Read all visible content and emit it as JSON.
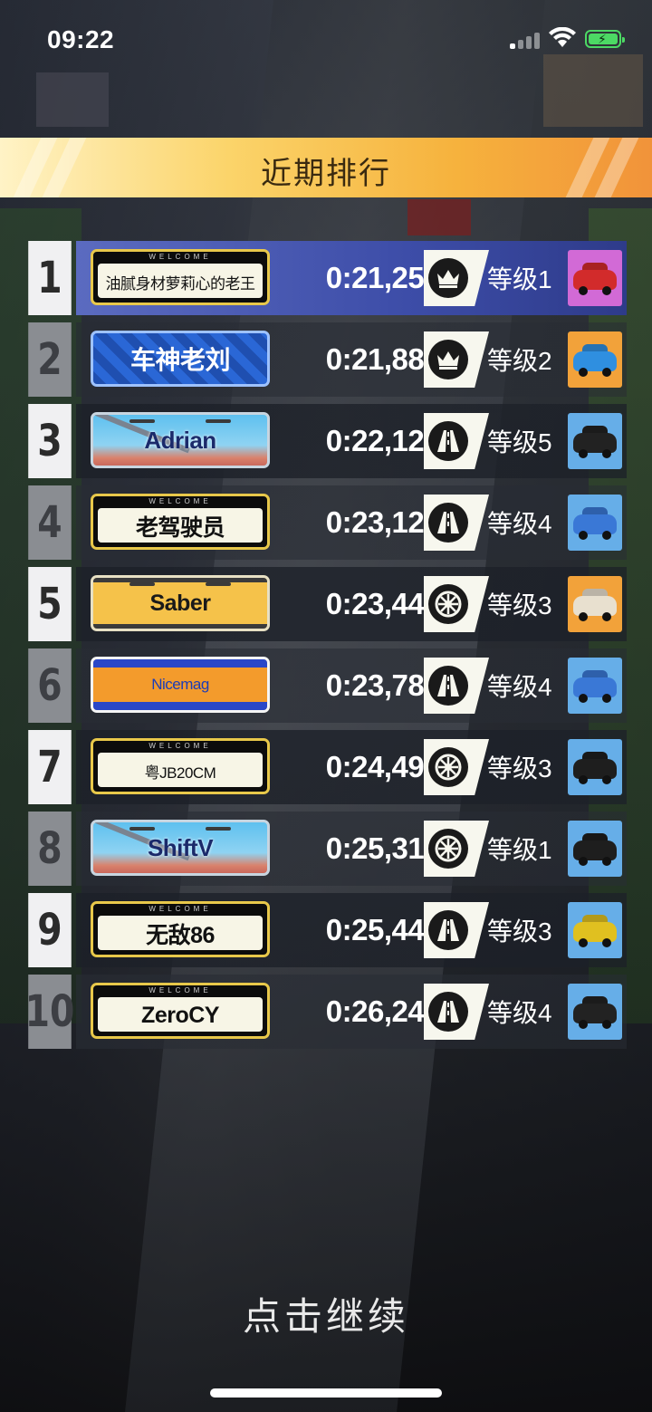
{
  "status_bar": {
    "time": "09:22",
    "battery_color": "#4cd964"
  },
  "header": {
    "title": "近期排行"
  },
  "leaderboard": [
    {
      "rank": "1",
      "player": "油腻身材萝莉心的老王",
      "plate_style": "black",
      "time": "0:21,25",
      "badge_icon": "crown-icon",
      "level": "等级1",
      "car_color": "#d22b2b",
      "car_bg": "#d26ad6"
    },
    {
      "rank": "2",
      "player": "车神老刘",
      "plate_style": "checker",
      "time": "0:21,88",
      "badge_icon": "crown-icon",
      "level": "等级2",
      "car_color": "#2f8fe0",
      "car_bg": "#f2a23a"
    },
    {
      "rank": "3",
      "player": "Adrian",
      "plate_style": "sky",
      "time": "0:22,12",
      "badge_icon": "road-icon",
      "level": "等级5",
      "car_color": "#222222",
      "car_bg": "#66aee8"
    },
    {
      "rank": "4",
      "player": "老驾驶员",
      "plate_style": "black",
      "time": "0:23,12",
      "badge_icon": "road-icon",
      "level": "等级4",
      "car_color": "#3a78d6",
      "car_bg": "#66aee8"
    },
    {
      "rank": "5",
      "player": "Saber",
      "plate_style": "yellow",
      "time": "0:23,44",
      "badge_icon": "wheel-icon",
      "level": "等级3",
      "car_color": "#e8e0cf",
      "car_bg": "#f2a23a"
    },
    {
      "rank": "6",
      "player": "Nicemag",
      "plate_style": "orange",
      "time": "0:23,78",
      "badge_icon": "road-icon",
      "level": "等级4",
      "car_color": "#3a78d6",
      "car_bg": "#66aee8"
    },
    {
      "rank": "7",
      "player": "粤JB20CM",
      "plate_style": "black",
      "time": "0:24,49",
      "badge_icon": "wheel-icon",
      "level": "等级3",
      "car_color": "#1e1e1e",
      "car_bg": "#66aee8"
    },
    {
      "rank": "8",
      "player": "ShiftV",
      "plate_style": "sky",
      "time": "0:25,31",
      "badge_icon": "wheel-icon",
      "level": "等级1",
      "car_color": "#1e1e1e",
      "car_bg": "#66aee8"
    },
    {
      "rank": "9",
      "player": "无敌86",
      "plate_style": "black",
      "time": "0:25,44",
      "badge_icon": "road-icon",
      "level": "等级3",
      "car_color": "#e0c020",
      "car_bg": "#66aee8"
    },
    {
      "rank": "10",
      "player": "ZeroCY",
      "plate_style": "black",
      "time": "0:26,24",
      "badge_icon": "road-icon",
      "level": "等级4",
      "car_color": "#222222",
      "car_bg": "#66aee8"
    }
  ],
  "footer": {
    "continue_label": "点击继续"
  }
}
